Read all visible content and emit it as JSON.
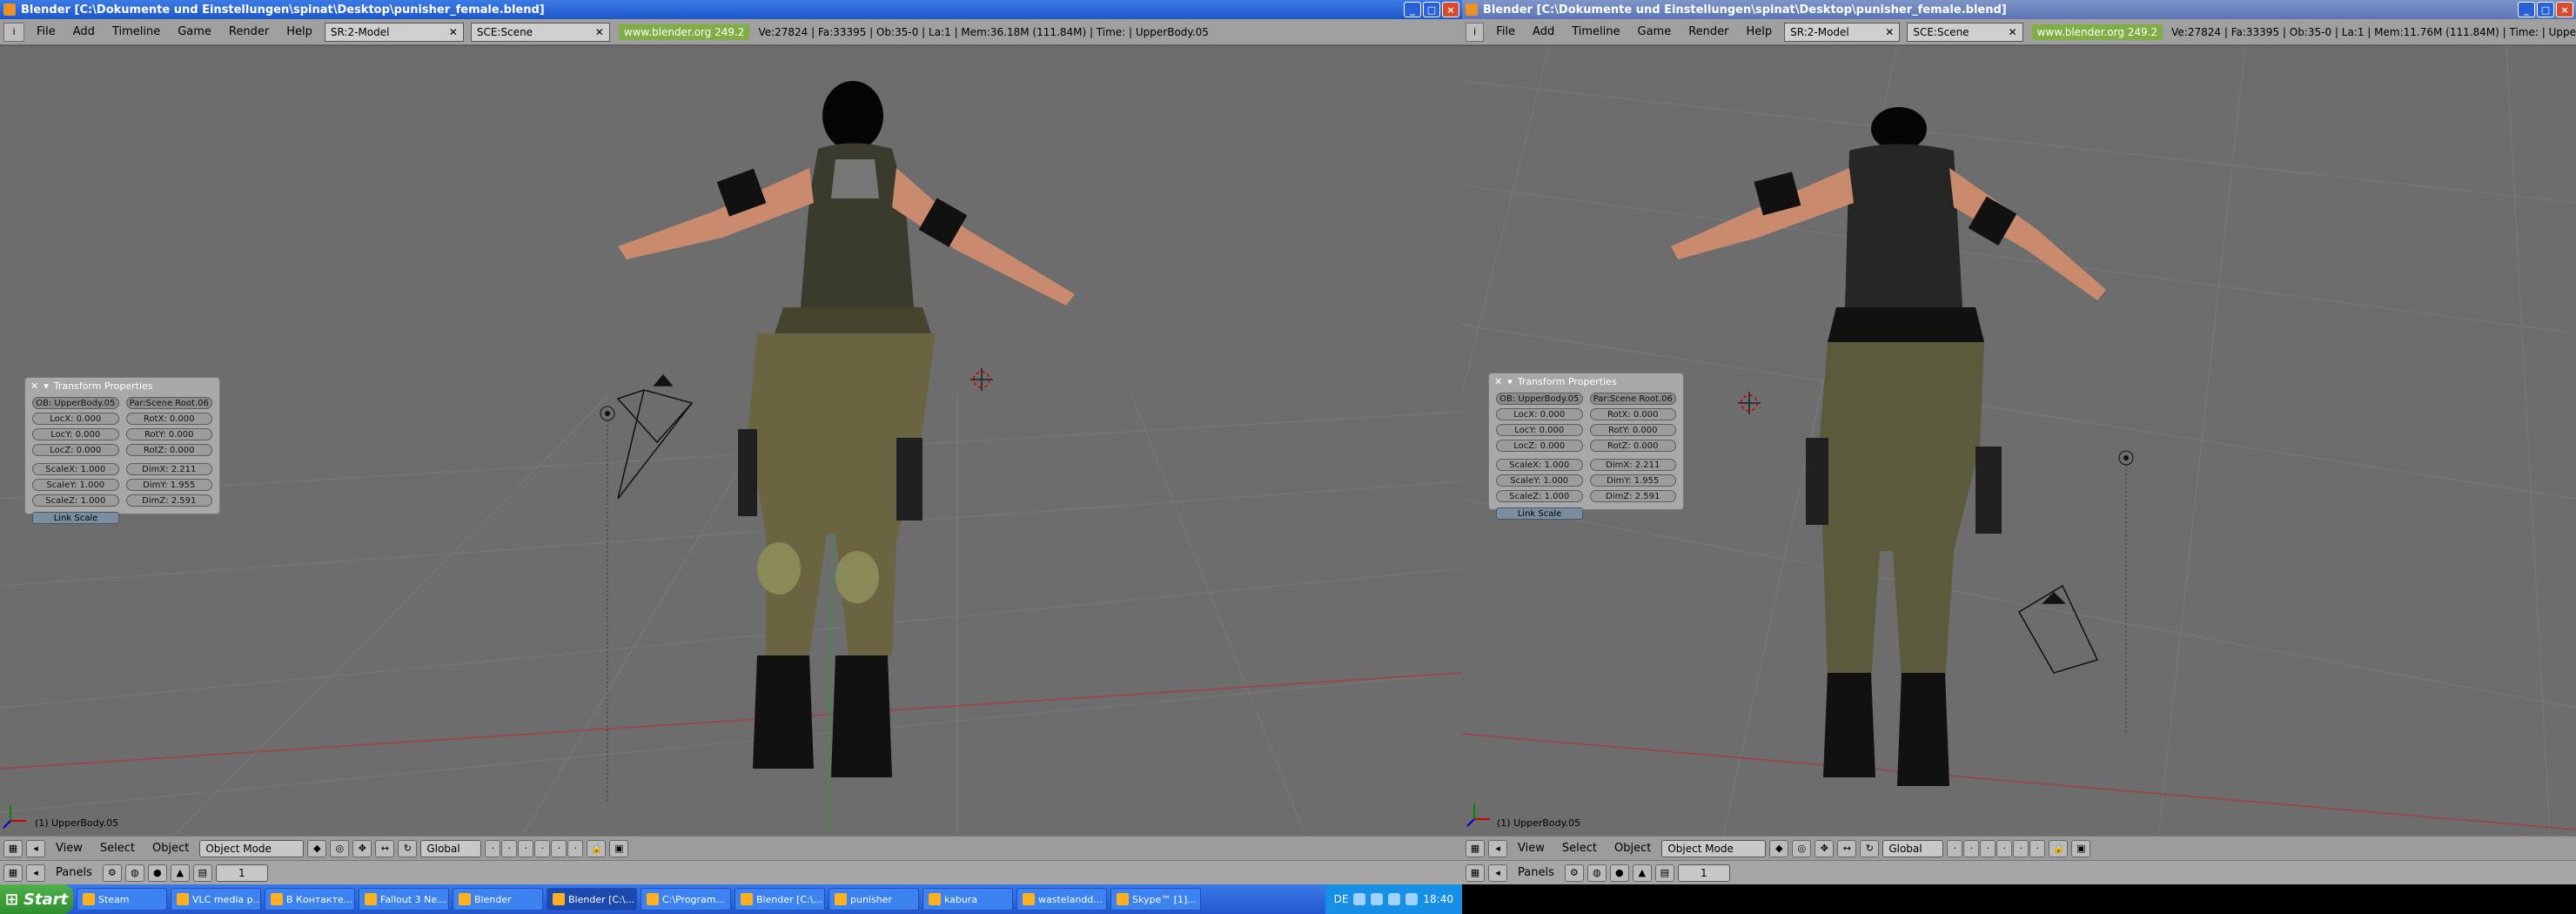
{
  "left": {
    "title": "Blender [C:\\Dokumente und Einstellungen\\spinat\\Desktop\\punisher_female.blend]",
    "menu": [
      "File",
      "Add",
      "Timeline",
      "Game",
      "Render",
      "Help"
    ],
    "screen_field": "SR:2-Model",
    "scene_field": "SCE:Scene",
    "www": "www.blender.org 249.2",
    "stats": "Ve:27824 | Fa:33395 | Ob:35-0 | La:1   | Mem:36.18M (111.84M)   | Time: | UpperBody.05",
    "object_label": "(1) UpperBody.05"
  },
  "right": {
    "title": "Blender [C:\\Dokumente und Einstellungen\\spinat\\Desktop\\punisher_female.blend]",
    "menu": [
      "File",
      "Add",
      "Timeline",
      "Game",
      "Render",
      "Help"
    ],
    "screen_field": "SR:2-Model",
    "scene_field": "SCE:Scene",
    "www": "www.blender.org 249.2",
    "stats": "Ve:27824 | Fa:33395 | Ob:35-0 | La:1   | Mem:11.76M (111.84M)   | Time: | Uppe",
    "object_label": "(1) UpperBody.05"
  },
  "transform": {
    "title": "Transform Properties",
    "ob": "OB: UpperBody.05",
    "par": "Par:Scene Root.06",
    "loc": [
      "LocX: 0.000",
      "LocY: 0.000",
      "LocZ: 0.000"
    ],
    "rot": [
      "RotX: 0.000",
      "RotY: 0.000",
      "RotZ: 0.000"
    ],
    "scale": [
      "ScaleX: 1.000",
      "ScaleY: 1.000",
      "ScaleZ: 1.000"
    ],
    "dim": [
      "DimX: 2.211",
      "DimY: 1.955",
      "DimZ: 2.591"
    ],
    "link_scale": "Link Scale"
  },
  "header3d": {
    "menu": [
      "View",
      "Select",
      "Object"
    ],
    "mode": "Object Mode",
    "orientation": "Global",
    "panels": "Panels",
    "frame": "1"
  },
  "taskbar": {
    "start": "Start",
    "tasks": [
      "Steam",
      "VLC media p...",
      "В Контакте...",
      "Fallout 3 Ne...",
      "Blender",
      "Blender [C:\\...",
      "C:\\Program...",
      "Blender [C:\\...",
      "punisher",
      "kabura",
      "wastelandd...",
      "Skype™ [1]..."
    ],
    "lang": "DE",
    "clock": "18:40"
  }
}
